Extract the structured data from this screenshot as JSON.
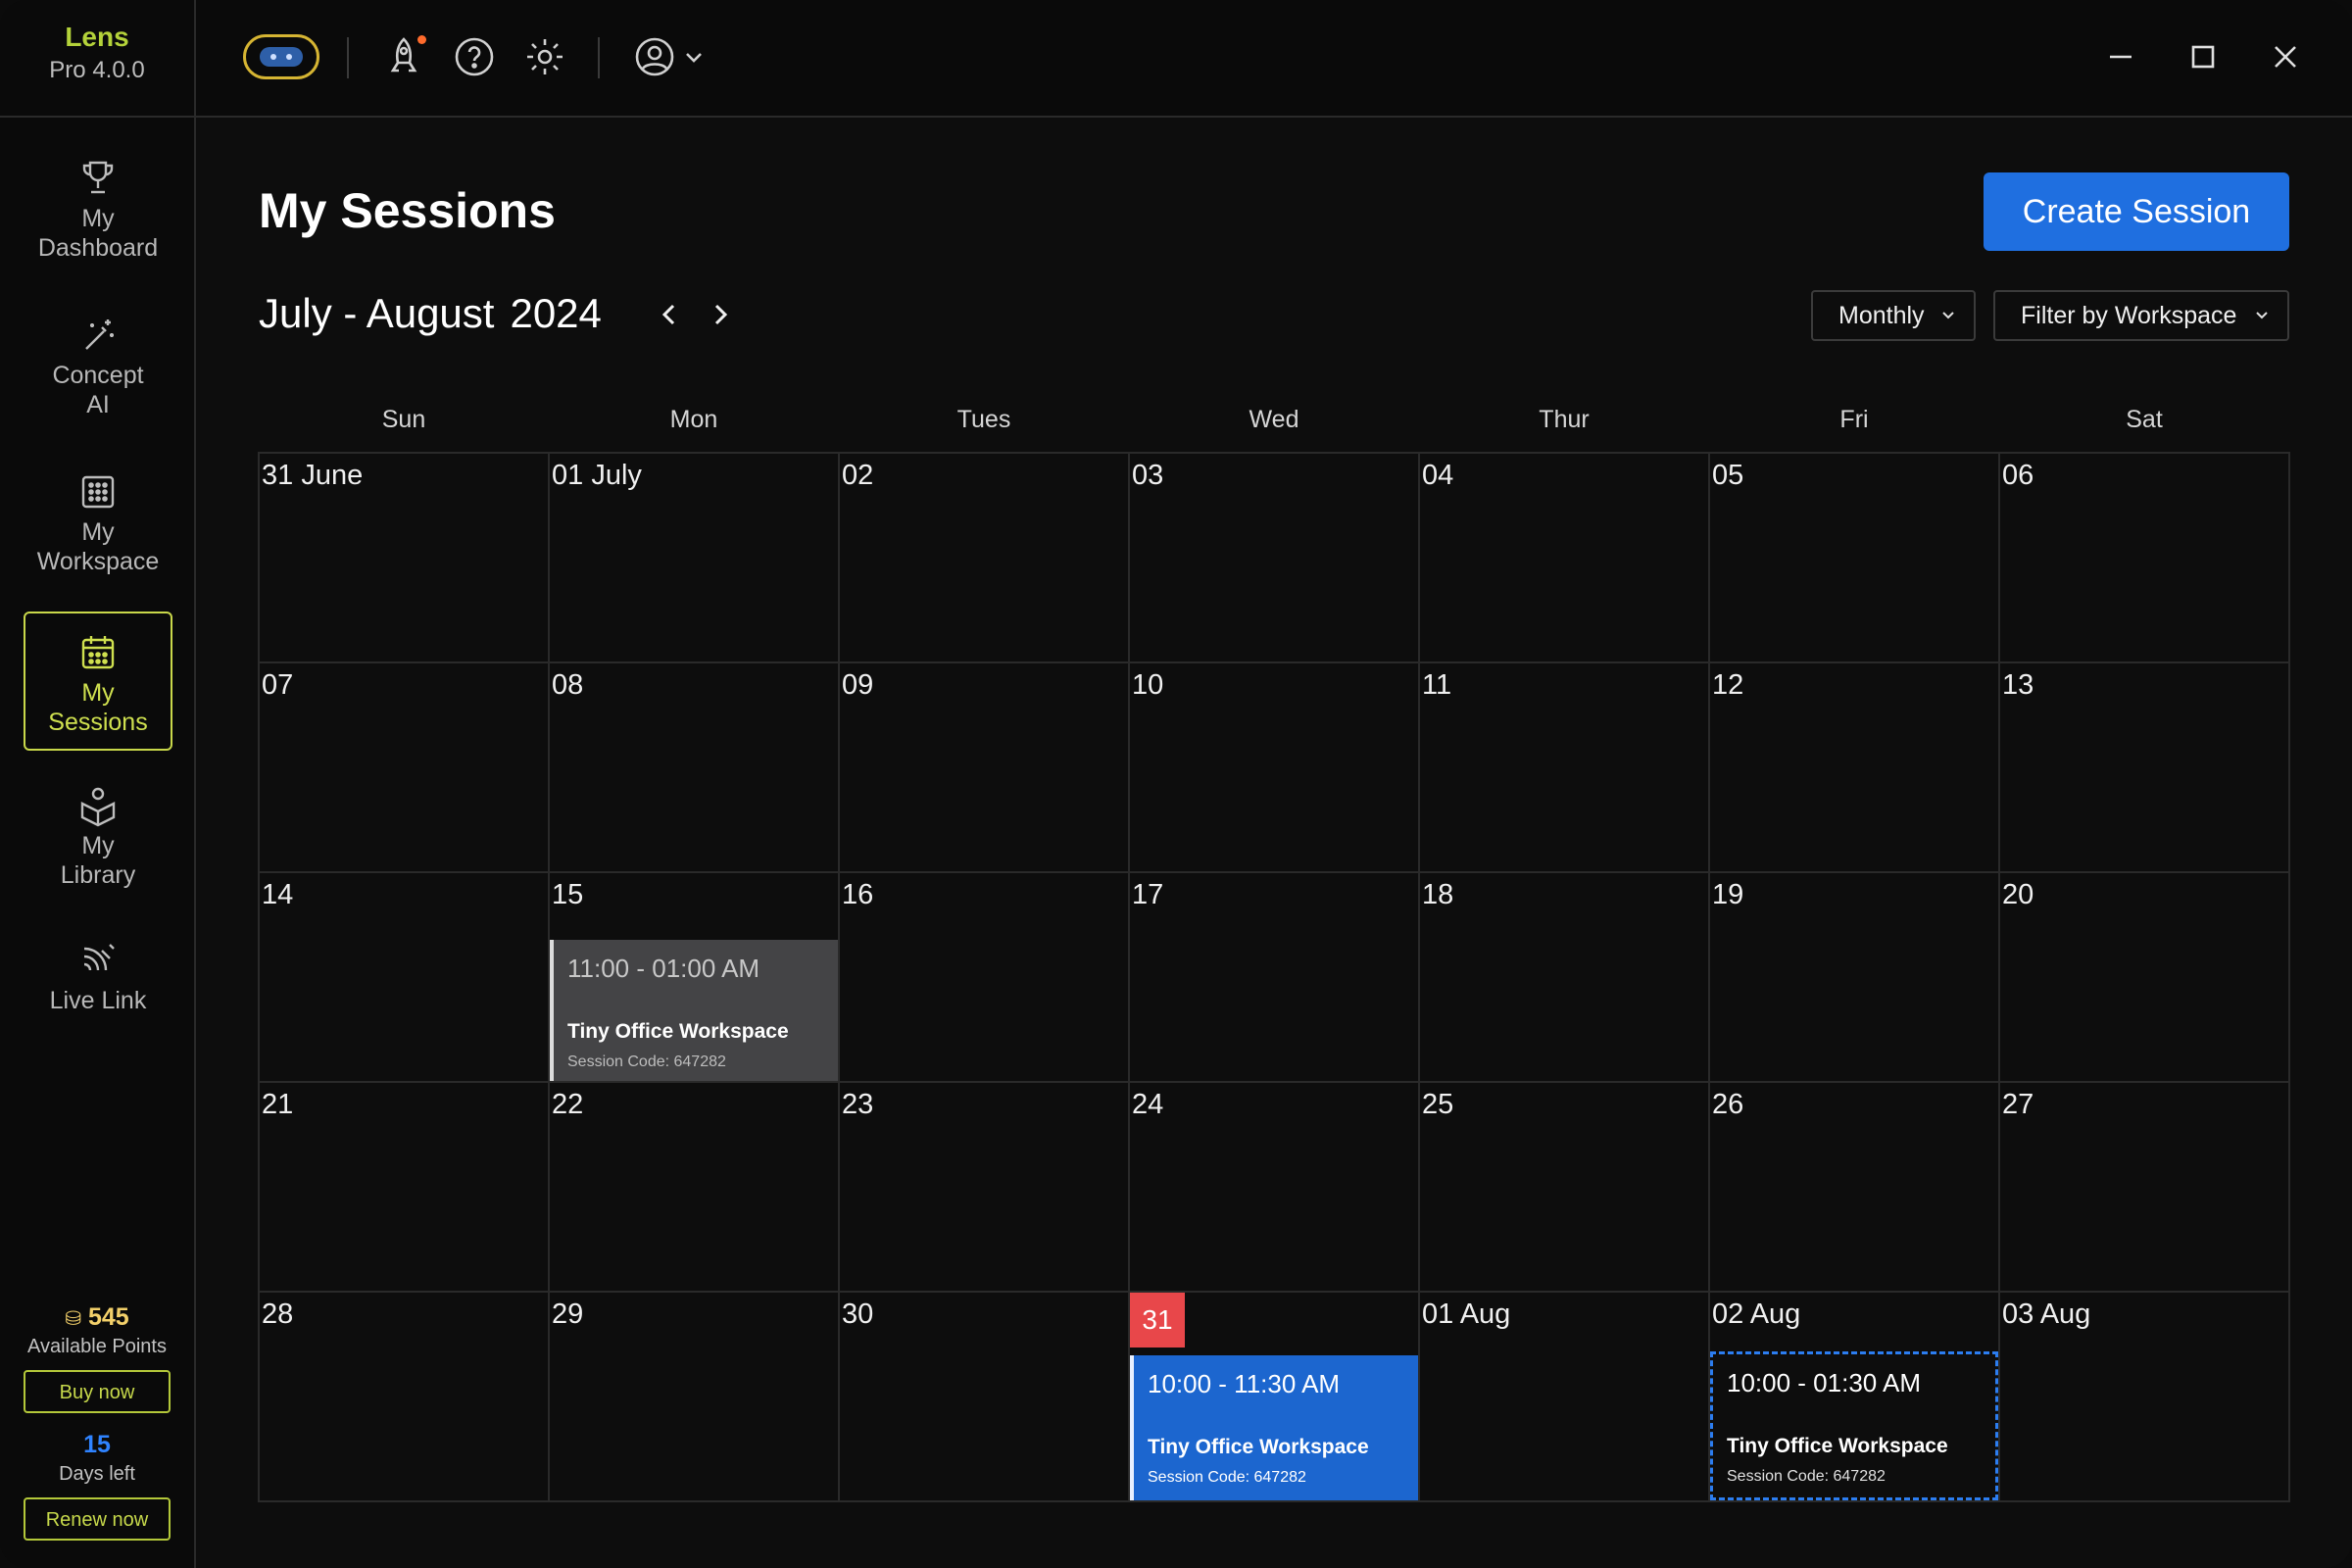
{
  "brand": {
    "name": "Lens",
    "version": "Pro 4.0.0"
  },
  "sidebar": {
    "items": [
      {
        "label_1": "My",
        "label_2": "Dashboard",
        "icon": "trophy-icon"
      },
      {
        "label_1": "Concept",
        "label_2": "AI",
        "icon": "magic-wand-icon"
      },
      {
        "label_1": "My",
        "label_2": "Workspace",
        "icon": "grid-icon"
      },
      {
        "label_1": "My",
        "label_2": "Sessions",
        "icon": "calendar-icon",
        "active": true
      },
      {
        "label_1": "My",
        "label_2": "Library",
        "icon": "book-icon"
      },
      {
        "label_1": "Live Link",
        "label_2": "",
        "icon": "signal-icon"
      }
    ],
    "points": {
      "value": "545",
      "label": "Available Points",
      "button": "Buy now"
    },
    "days": {
      "value": "15",
      "label": "Days left",
      "button": "Renew now"
    }
  },
  "topbar": {
    "icons": [
      "avatar-pill-icon",
      "rocket-icon",
      "help-icon",
      "settings-icon",
      "user-icon",
      "chevron-down-icon"
    ],
    "window_controls": [
      "minimize-icon",
      "maximize-icon",
      "close-icon"
    ]
  },
  "main": {
    "title": "My Sessions",
    "create_button": "Create Session",
    "range_label": "July - August",
    "range_year": "2024",
    "view_select": "Monthly",
    "filter_select": "Filter by Workspace"
  },
  "calendar": {
    "weekdays": [
      "Sun",
      "Mon",
      "Tues",
      "Wed",
      "Thur",
      "Fri",
      "Sat"
    ],
    "weeks": [
      [
        "31 June",
        "01 July",
        "02",
        "03",
        "04",
        "05",
        "06"
      ],
      [
        "07",
        "08",
        "09",
        "10",
        "11",
        "12",
        "13"
      ],
      [
        "14",
        "15",
        "16",
        "17",
        "18",
        "19",
        "20"
      ],
      [
        "21",
        "22",
        "23",
        "24",
        "25",
        "26",
        "27"
      ],
      [
        "28",
        "29",
        "30",
        "31",
        "01 Aug",
        "02 Aug",
        "03 Aug"
      ]
    ],
    "today": "31",
    "events": [
      {
        "time": "11:00 - 01:00 AM",
        "workspace": "Tiny Office Workspace",
        "code": "Session Code: 647282",
        "style": "grey"
      },
      {
        "time": "10:00 - 11:30 AM",
        "workspace": "Tiny Office Workspace",
        "code": "Session Code: 647282",
        "style": "blue"
      },
      {
        "time": "10:00 - 01:30 AM",
        "workspace": "Tiny Office Workspace",
        "code": "Session Code: 647282",
        "style": "dashed"
      }
    ]
  },
  "colors": {
    "accent_blue": "#1f6fe0",
    "brand_green": "#b4d23a",
    "today_red": "#e8474a",
    "points_gold": "#f3d06a"
  }
}
